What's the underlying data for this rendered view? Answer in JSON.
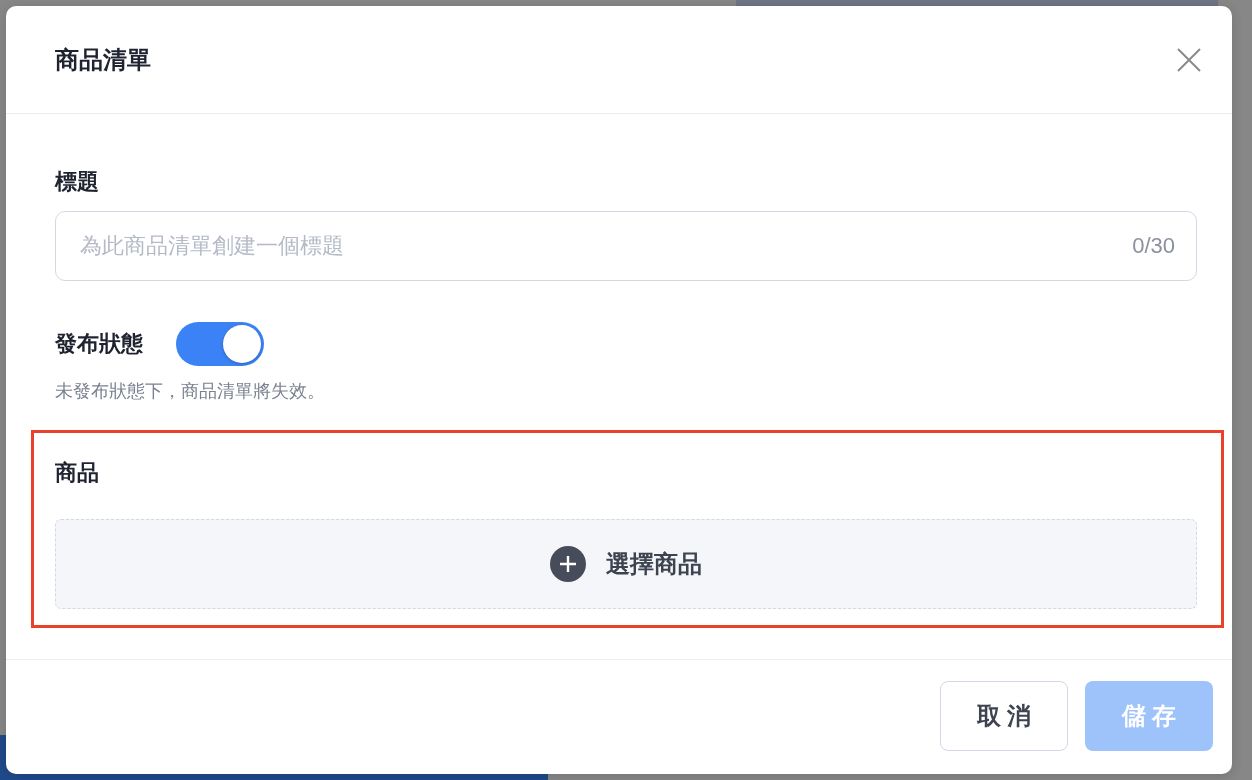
{
  "dialog": {
    "title": "商品清單"
  },
  "title_field": {
    "label": "標題",
    "placeholder": "為此商品清單創建一個標題",
    "counter": "0/30"
  },
  "publish": {
    "label": "發布狀態",
    "on": true,
    "hint": "未發布狀態下，商品清單將失效。"
  },
  "products": {
    "label": "商品",
    "highlighted": true,
    "add_button": "選擇商品"
  },
  "buttons": [
    {
      "label": "取 消",
      "kind": "secondary",
      "disabled": false
    },
    {
      "label": "儲 存",
      "kind": "primary",
      "disabled": true
    }
  ]
}
